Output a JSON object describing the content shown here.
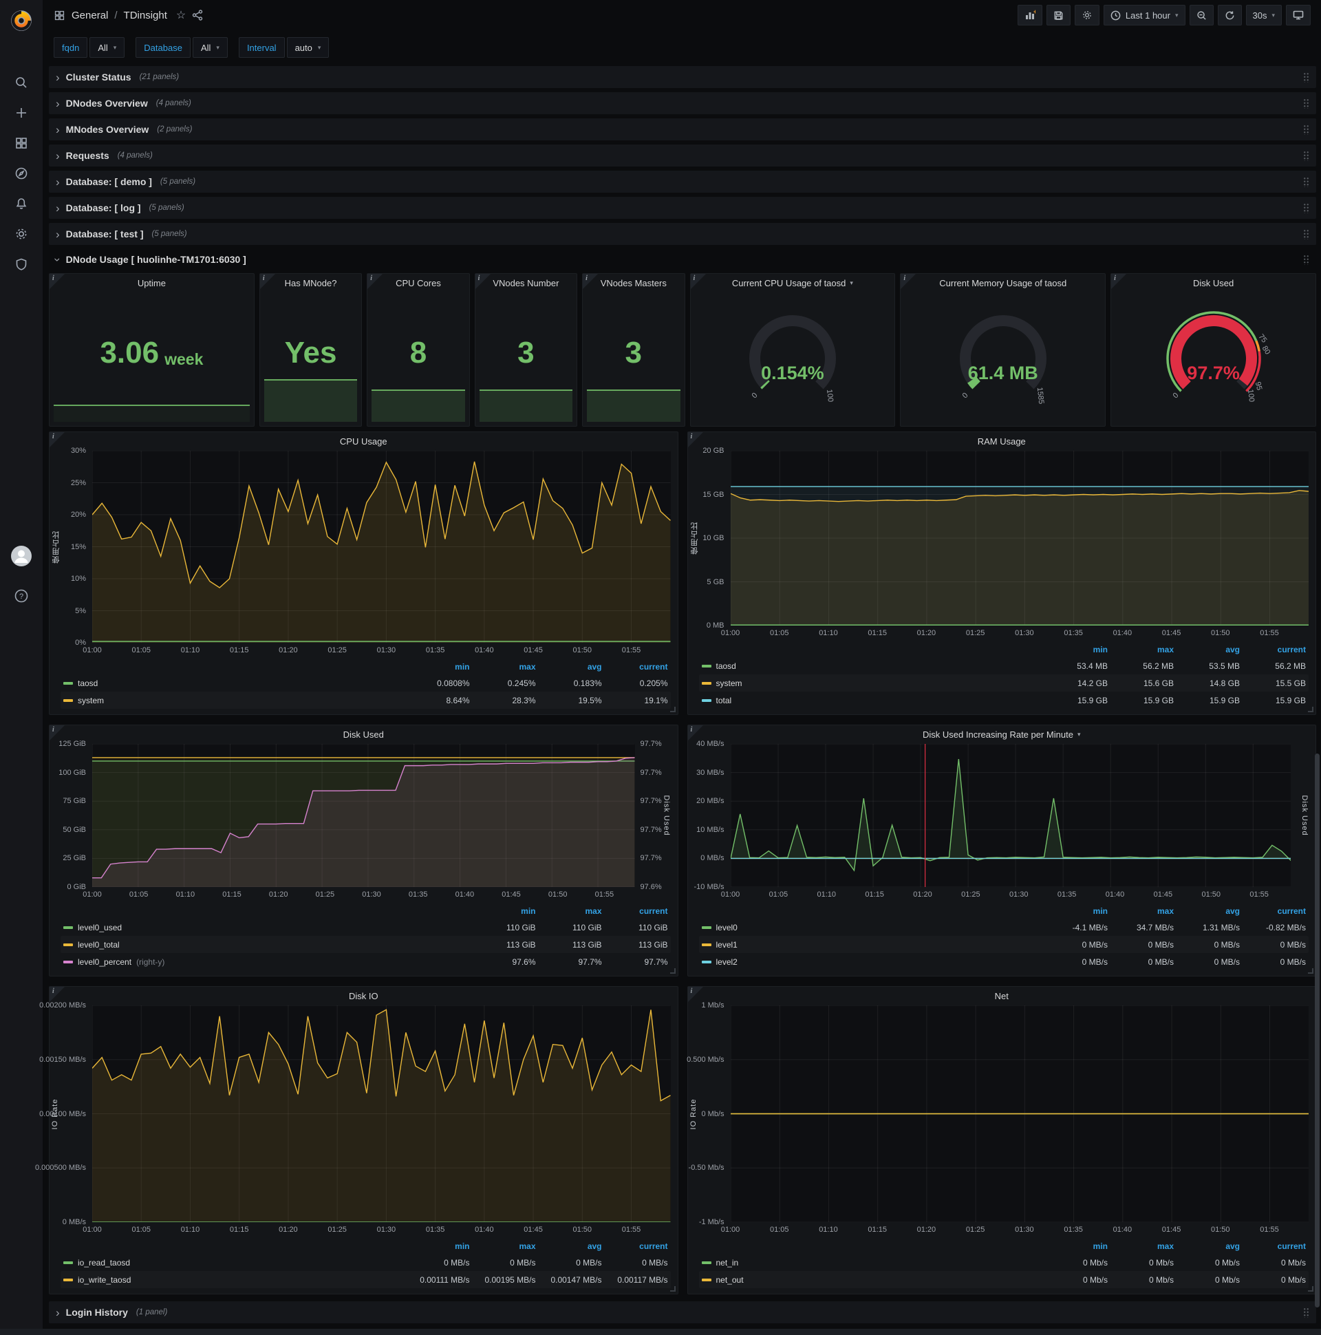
{
  "icons": {
    "info": "i",
    "chevron_right": "›",
    "caret_down": "▾",
    "star": "☆",
    "help": "?"
  },
  "colors": {
    "green": "#73bf69",
    "yellow": "#eab839",
    "cyan": "#6ed0e0",
    "pink": "#d683ce",
    "red": "#e02f44",
    "orange": "#ff9830",
    "blue": "#33a2e5"
  },
  "topnav": {
    "breadcrumb": {
      "section": "General",
      "separator": "/",
      "title": "TDinsight"
    },
    "time_range": "Last 1 hour",
    "refresh_interval": "30s"
  },
  "variables": [
    {
      "label": "fqdn",
      "value": "All"
    },
    {
      "label": "Database",
      "value": "All"
    },
    {
      "label": "Interval",
      "value": "auto"
    }
  ],
  "rows": [
    {
      "title": "Cluster Status",
      "count": "(21 panels)"
    },
    {
      "title": "DNodes Overview",
      "count": "(4 panels)"
    },
    {
      "title": "MNodes Overview",
      "count": "(2 panels)"
    },
    {
      "title": "Requests",
      "count": "(4 panels)"
    },
    {
      "title": "Database: [ demo ]",
      "count": "(5 panels)"
    },
    {
      "title": "Database: [ log ]",
      "count": "(5 panels)"
    },
    {
      "title": "Database: [ test ]",
      "count": "(5 panels)"
    }
  ],
  "expanded_row": {
    "title": "DNode Usage [ huolinhe-TM1701:6030 ]"
  },
  "login_row": {
    "title": "Login History",
    "count": "(1 panel)"
  },
  "stats": [
    {
      "title": "Uptime",
      "value": "3.06",
      "suffix": "week"
    },
    {
      "title": "Has MNode?",
      "value": "Yes"
    },
    {
      "title": "CPU Cores",
      "value": "8"
    },
    {
      "title": "VNodes Number",
      "value": "3"
    },
    {
      "title": "VNodes Masters",
      "value": "3"
    }
  ],
  "gauges": [
    {
      "title": "Current CPU Usage of taosd",
      "dropdown": true,
      "value": "0.154%",
      "color": "#73bf69",
      "fraction": 0.0015,
      "labels": [
        {
          "text": "0",
          "frac": 0
        },
        {
          "text": "100",
          "frac": 1
        }
      ]
    },
    {
      "title": "Current Memory Usage of taosd",
      "value": "61.4 MB",
      "color": "#73bf69",
      "fraction": 0.039,
      "labels": [
        {
          "text": "0",
          "frac": 0
        },
        {
          "text": "1585",
          "frac": 1
        }
      ]
    },
    {
      "title": "Disk Used",
      "value": "97.7%",
      "color": "#e02f44",
      "fraction": 0.977,
      "ring": [
        {
          "to": 0.75,
          "color": "#73bf69"
        },
        {
          "to": 0.8,
          "color": "#ff9830"
        },
        {
          "to": 1,
          "color": "#e02f44"
        }
      ],
      "labels": [
        {
          "text": "0",
          "frac": 0
        },
        {
          "text": "75",
          "frac": 0.75
        },
        {
          "text": "80",
          "frac": 0.8
        },
        {
          "text": "95",
          "frac": 0.95
        },
        {
          "text": "100",
          "frac": 1
        }
      ]
    }
  ],
  "panels": {
    "cpu_usage": {
      "title": "CPU Usage",
      "y_axis": {
        "title": "使用占比",
        "ticks": [
          "30%",
          "25%",
          "20%",
          "15%",
          "10%",
          "5%",
          "0%"
        ]
      },
      "x_ticks": [
        "01:00",
        "01:05",
        "01:10",
        "01:15",
        "01:20",
        "01:25",
        "01:30",
        "01:35",
        "01:40",
        "01:45",
        "01:50",
        "01:55"
      ],
      "chart": {
        "type": "line",
        "ymin": 0,
        "ymax": 30,
        "x_count": 60,
        "series": [
          {
            "name": "system",
            "color": "#eab839",
            "fill": 0.13,
            "values": [
              20.0,
              21.8,
              19.6,
              16.2,
              16.5,
              18.8,
              17.5,
              13.5,
              19.4,
              16.0,
              9.3,
              12.0,
              9.6,
              8.6,
              10.0,
              16.4,
              24.5,
              20.3,
              15.3,
              24.0,
              20.5,
              25.4,
              18.6,
              23.1,
              16.6,
              15.4,
              21.0,
              16.1,
              21.9,
              24.3,
              28.2,
              25.5,
              20.4,
              25.2,
              14.9,
              24.7,
              16.2,
              24.6,
              19.8,
              28.3,
              21.5,
              17.5,
              20.3,
              21.1,
              22.0,
              16.1,
              25.6,
              22.2,
              21.0,
              18.4,
              14.0,
              14.8,
              25.0,
              21.5,
              27.9,
              26.5,
              18.6,
              24.4,
              20.5,
              19.1
            ]
          },
          {
            "name": "taosd",
            "color": "#73bf69",
            "fill": 0.06,
            "const": 0.2
          }
        ]
      },
      "legend": {
        "columns": [
          "min",
          "max",
          "avg",
          "current"
        ],
        "rows": [
          {
            "name": "taosd",
            "color": "#73bf69",
            "values": [
              "0.0808%",
              "0.245%",
              "0.183%",
              "0.205%"
            ]
          },
          {
            "name": "system",
            "color": "#eab839",
            "values": [
              "8.64%",
              "28.3%",
              "19.5%",
              "19.1%"
            ]
          }
        ]
      }
    },
    "ram_usage": {
      "title": "RAM Usage",
      "y_axis": {
        "title": "使用占比",
        "ticks": [
          "20 GB",
          "15 GB",
          "10 GB",
          "5 GB",
          "0 MB"
        ]
      },
      "x_ticks": [
        "01:00",
        "01:05",
        "01:10",
        "01:15",
        "01:20",
        "01:25",
        "01:30",
        "01:35",
        "01:40",
        "01:45",
        "01:50",
        "01:55"
      ],
      "chart": {
        "type": "line",
        "ymin": 0,
        "ymax": 20,
        "x_count": 60,
        "series": [
          {
            "name": "total",
            "color": "#6ed0e0",
            "fill": 0.08,
            "const": 15.9
          },
          {
            "name": "system",
            "color": "#eab839",
            "fill": 0.12,
            "values": [
              15.1,
              14.6,
              14.35,
              14.4,
              14.35,
              14.3,
              14.35,
              14.3,
              14.25,
              14.3,
              14.25,
              14.2,
              14.25,
              14.3,
              14.25,
              14.3,
              14.35,
              14.3,
              14.35,
              14.3,
              14.35,
              14.3,
              14.35,
              14.4,
              14.8,
              14.85,
              14.9,
              14.85,
              14.9,
              14.95,
              14.9,
              14.95,
              14.9,
              14.95,
              14.9,
              14.95,
              15.0,
              14.95,
              15.0,
              14.95,
              15.0,
              15.05,
              15.0,
              15.05,
              15.0,
              15.05,
              15.1,
              15.05,
              15.1,
              15.05,
              15.1,
              15.1,
              15.05,
              15.1,
              15.15,
              15.1,
              15.15,
              15.2,
              15.45,
              15.35
            ]
          },
          {
            "name": "taosd",
            "color": "#73bf69",
            "fill": 0,
            "const": 0.06
          }
        ]
      },
      "legend": {
        "columns": [
          "min",
          "max",
          "avg",
          "current"
        ],
        "rows": [
          {
            "name": "taosd",
            "color": "#73bf69",
            "values": [
              "53.4 MB",
              "56.2 MB",
              "53.5 MB",
              "56.2 MB"
            ]
          },
          {
            "name": "system",
            "color": "#eab839",
            "values": [
              "14.2 GB",
              "15.6 GB",
              "14.8 GB",
              "15.5 GB"
            ]
          },
          {
            "name": "total",
            "color": "#6ed0e0",
            "values": [
              "15.9 GB",
              "15.9 GB",
              "15.9 GB",
              "15.9 GB"
            ]
          }
        ]
      }
    },
    "disk_used": {
      "title": "Disk Used",
      "y_axis": {
        "title": "",
        "ticks": [
          "125 GiB",
          "100 GiB",
          "75 GiB",
          "50 GiB",
          "25 GiB",
          "0 GiB"
        ]
      },
      "y_axis_right": {
        "title": "Disk Used",
        "ticks": [
          "97.7%",
          "97.7%",
          "97.7%",
          "97.7%",
          "97.7%",
          "97.6%"
        ]
      },
      "x_ticks": [
        "01:00",
        "01:05",
        "01:10",
        "01:15",
        "01:20",
        "01:25",
        "01:30",
        "01:35",
        "01:40",
        "01:45",
        "01:50",
        "01:55"
      ],
      "chart": {
        "type": "line",
        "ymin": 0,
        "ymax": 125,
        "x_count": 60,
        "series": [
          {
            "name": "level0_total",
            "color": "#eab839",
            "fill": 0.06,
            "const": 113
          },
          {
            "name": "level0_used",
            "color": "#73bf69",
            "fill": 0.08,
            "const": 110
          },
          {
            "name": "level0_percent",
            "color": "#d683ce",
            "fill": 0.1,
            "values": [
              8,
              8,
              20,
              21,
              21.5,
              22,
              22,
              33,
              33,
              33.5,
              33.5,
              33.5,
              33.5,
              33.5,
              30,
              47,
              43,
              44,
              55,
              55,
              55,
              55.5,
              55.5,
              55.5,
              84,
              84,
              84,
              84,
              84,
              84.5,
              84.5,
              84.5,
              84.5,
              84.5,
              106,
              106,
              106,
              106.5,
              106.5,
              107,
              107,
              107,
              107.5,
              107.5,
              107.5,
              108,
              108,
              108,
              108,
              108.5,
              108.5,
              108.5,
              109,
              109,
              109,
              109.5,
              109.5,
              110,
              112.5,
              113
            ]
          }
        ]
      },
      "legend": {
        "columns": [
          "min",
          "max",
          "current"
        ],
        "rows": [
          {
            "name": "level0_used",
            "color": "#73bf69",
            "values": [
              "110 GiB",
              "110 GiB",
              "110 GiB"
            ]
          },
          {
            "name": "level0_total",
            "color": "#eab839",
            "values": [
              "113 GiB",
              "113 GiB",
              "113 GiB"
            ]
          },
          {
            "name": "level0_percent",
            "color": "#d683ce",
            "suffix": "(right-y)",
            "values": [
              "97.6%",
              "97.7%",
              "97.7%"
            ]
          }
        ]
      }
    },
    "disk_rate": {
      "title": "Disk Used Increasing Rate per Minute",
      "dropdown": true,
      "y_axis": {
        "title": "",
        "ticks": [
          "40 MB/s",
          "30 MB/s",
          "20 MB/s",
          "10 MB/s",
          "0 MB/s",
          "-10 MB/s"
        ]
      },
      "y_axis_right": {
        "title": "Disk Used",
        "ticks": []
      },
      "x_ticks": [
        "01:00",
        "01:05",
        "01:10",
        "01:15",
        "01:20",
        "01:25",
        "01:30",
        "01:35",
        "01:40",
        "01:45",
        "01:50",
        "01:55"
      ],
      "chart": {
        "type": "line",
        "ymin": -10,
        "ymax": 40,
        "x_count": 60,
        "annotation_x": 0.347,
        "series": [
          {
            "name": "level0",
            "color": "#73bf69",
            "fill": 0.14,
            "values": [
              0,
              15.5,
              0.3,
              0.2,
              2.6,
              0.2,
              0.3,
              11.5,
              0.4,
              0.3,
              0.5,
              0.3,
              0.4,
              -4.2,
              21.0,
              -2.6,
              0.3,
              11.6,
              0.4,
              0.2,
              0.3,
              -0.8,
              0.3,
              0.4,
              34.7,
              1.2,
              -0.6,
              0.2,
              0.3,
              0.2,
              0.4,
              0.3,
              0.2,
              0.5,
              21.0,
              0.4,
              0.3,
              0.2,
              0.3,
              0.4,
              0.2,
              0.3,
              0.5,
              0.3,
              0.2,
              0.4,
              0.3,
              0.2,
              0.3,
              0.5,
              0.4,
              0.2,
              0.3,
              0.4,
              0.3,
              0.2,
              0.4,
              4.6,
              2.5,
              -0.8
            ]
          },
          {
            "name": "level1",
            "color": "#eab839",
            "fill": 0,
            "const": 0
          },
          {
            "name": "level2",
            "color": "#6ed0e0",
            "fill": 0,
            "const": 0
          }
        ]
      },
      "legend": {
        "columns": [
          "min",
          "max",
          "avg",
          "current"
        ],
        "rows": [
          {
            "name": "level0",
            "color": "#73bf69",
            "values": [
              "-4.1 MB/s",
              "34.7 MB/s",
              "1.31 MB/s",
              "-0.82 MB/s"
            ]
          },
          {
            "name": "level1",
            "color": "#eab839",
            "values": [
              "0 MB/s",
              "0 MB/s",
              "0 MB/s",
              "0 MB/s"
            ]
          },
          {
            "name": "level2",
            "color": "#6ed0e0",
            "values": [
              "0 MB/s",
              "0 MB/s",
              "0 MB/s",
              "0 MB/s"
            ]
          }
        ]
      }
    },
    "disk_io": {
      "title": "Disk IO",
      "y_axis": {
        "title": "IO Rate",
        "ticks": [
          "0.00200 MB/s",
          "0.00150 MB/s",
          "0.00100 MB/s",
          "0.000500 MB/s",
          "0 MB/s"
        ]
      },
      "x_ticks": [
        "01:00",
        "01:05",
        "01:10",
        "01:15",
        "01:20",
        "01:25",
        "01:30",
        "01:35",
        "01:40",
        "01:45",
        "01:50",
        "01:55"
      ],
      "chart": {
        "type": "line",
        "ymin": 0,
        "ymax": 0.002,
        "x_count": 60,
        "series": [
          {
            "name": "io_write_taosd",
            "color": "#eab839",
            "fill": 0.12,
            "values": [
              0.00142,
              0.00152,
              0.00131,
              0.00136,
              0.00131,
              0.00155,
              0.00156,
              0.00162,
              0.00142,
              0.00155,
              0.00143,
              0.00152,
              0.00128,
              0.0019,
              0.00117,
              0.00152,
              0.00155,
              0.00129,
              0.00175,
              0.00164,
              0.00146,
              0.00118,
              0.0019,
              0.00147,
              0.00133,
              0.00137,
              0.00175,
              0.00166,
              0.00119,
              0.00191,
              0.00196,
              0.00116,
              0.00175,
              0.00144,
              0.00139,
              0.00158,
              0.00121,
              0.00136,
              0.00183,
              0.00129,
              0.00186,
              0.00133,
              0.00184,
              0.00117,
              0.0015,
              0.00172,
              0.00129,
              0.00164,
              0.00163,
              0.00142,
              0.0017,
              0.00122,
              0.00145,
              0.00157,
              0.00136,
              0.00145,
              0.00139,
              0.00196,
              0.00112,
              0.00117
            ]
          },
          {
            "name": "io_read_taosd",
            "color": "#73bf69",
            "fill": 0,
            "const": 0
          }
        ]
      },
      "legend": {
        "columns": [
          "min",
          "max",
          "avg",
          "current"
        ],
        "rows": [
          {
            "name": "io_read_taosd",
            "color": "#73bf69",
            "values": [
              "0 MB/s",
              "0 MB/s",
              "0 MB/s",
              "0 MB/s"
            ]
          },
          {
            "name": "io_write_taosd",
            "color": "#eab839",
            "values": [
              "0.00111 MB/s",
              "0.00195 MB/s",
              "0.00147 MB/s",
              "0.00117 MB/s"
            ]
          }
        ]
      }
    },
    "net": {
      "title": "Net",
      "y_axis": {
        "title": "IO Rate",
        "ticks": [
          "1 Mb/s",
          "0.500 Mb/s",
          "0 Mb/s",
          "-0.50 Mb/s",
          "-1 Mb/s"
        ]
      },
      "x_ticks": [
        "01:00",
        "01:05",
        "01:10",
        "01:15",
        "01:20",
        "01:25",
        "01:30",
        "01:35",
        "01:40",
        "01:45",
        "01:50",
        "01:55"
      ],
      "chart": {
        "type": "line",
        "ymin": -1,
        "ymax": 1,
        "x_count": 60,
        "series": [
          {
            "name": "net_in",
            "color": "#73bf69",
            "fill": 0,
            "const": 0
          },
          {
            "name": "net_out",
            "color": "#eab839",
            "fill": 0,
            "const": 0
          }
        ]
      },
      "legend": {
        "columns": [
          "min",
          "max",
          "avg",
          "current"
        ],
        "rows": [
          {
            "name": "net_in",
            "color": "#73bf69",
            "values": [
              "0 Mb/s",
              "0 Mb/s",
              "0 Mb/s",
              "0 Mb/s"
            ]
          },
          {
            "name": "net_out",
            "color": "#eab839",
            "values": [
              "0 Mb/s",
              "0 Mb/s",
              "0 Mb/s",
              "0 Mb/s"
            ]
          }
        ]
      }
    }
  }
}
